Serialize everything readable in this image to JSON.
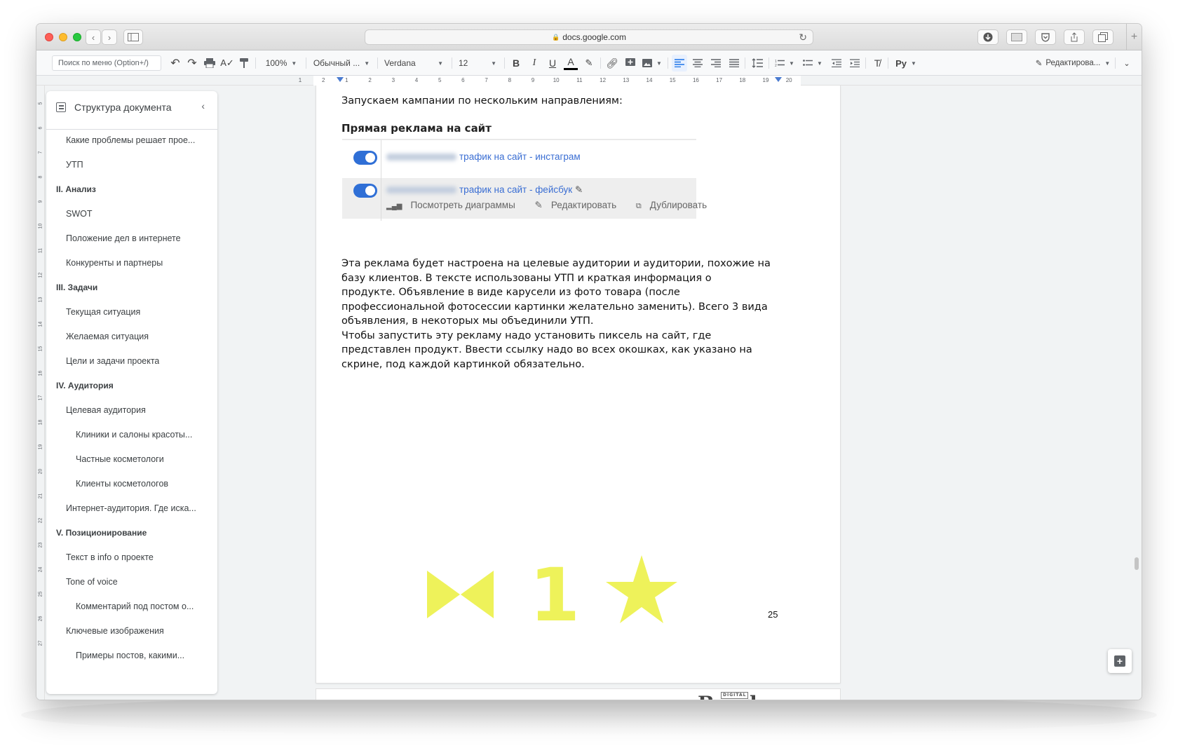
{
  "browser": {
    "url": "docs.google.com",
    "nav_back": "‹",
    "nav_forward": "›",
    "new_tab": "+"
  },
  "toolbar": {
    "search_placeholder": "Поиск по меню (Option+/)",
    "zoom": "100%",
    "style": "Обычный ...",
    "font": "Verdana",
    "font_size": "12",
    "bold": "B",
    "italic": "I",
    "underline": "U",
    "text_color": "A",
    "input_tools": "Ру",
    "editing_mode": "Редактирова..."
  },
  "ruler": {
    "ticks": [
      "1",
      "2",
      "1",
      "2",
      "3",
      "4",
      "5",
      "6",
      "7",
      "8",
      "9",
      "10",
      "11",
      "12",
      "13",
      "14",
      "15",
      "16",
      "17",
      "18",
      "19",
      "20"
    ],
    "vticks": [
      "5",
      "6",
      "7",
      "8",
      "9",
      "10",
      "11",
      "12",
      "13",
      "14",
      "15",
      "16",
      "17",
      "18",
      "19",
      "20",
      "21",
      "22",
      "23",
      "24",
      "25",
      "26",
      "27"
    ]
  },
  "outline": {
    "title": "Структура документа",
    "close": "‹",
    "items": [
      {
        "label": "Какие проблемы решает прое...",
        "level": 1
      },
      {
        "label": "УТП",
        "level": 1
      },
      {
        "label": "II. Анализ",
        "level": 0
      },
      {
        "label": "SWOT",
        "level": 1
      },
      {
        "label": "Положение дел в интернете",
        "level": 1
      },
      {
        "label": "Конкуренты и партнеры",
        "level": 1
      },
      {
        "label": "III. Задачи",
        "level": 0
      },
      {
        "label": "Текущая ситуация",
        "level": 1
      },
      {
        "label": "Желаемая ситуация",
        "level": 1
      },
      {
        "label": "Цели и задачи проекта",
        "level": 1
      },
      {
        "label": "IV. Аудитория",
        "level": 0
      },
      {
        "label": "Целевая аудитория",
        "level": 1
      },
      {
        "label": "Клиники и салоны красоты...",
        "level": 2
      },
      {
        "label": "Частные косметологи",
        "level": 2
      },
      {
        "label": "Клиенты косметологов",
        "level": 2
      },
      {
        "label": "Интернет-аудитория. Где иска...",
        "level": 1
      },
      {
        "label": "V. Позиционирование",
        "level": 0
      },
      {
        "label": "Текст в info о проекте",
        "level": 1
      },
      {
        "label": "Tone of voice",
        "level": 1
      },
      {
        "label": "Комментарий под постом о...",
        "level": 2
      },
      {
        "label": "Ключевые изображения",
        "level": 1
      },
      {
        "label": "Примеры постов, какими...",
        "level": 2
      }
    ]
  },
  "document": {
    "intro": "Запускаем кампании по нескольким направлениям:",
    "heading": "Прямая реклама на сайт",
    "screenshot": {
      "campaign1": "трафик на сайт - инстаграм",
      "campaign2": "трафик на сайт - фейсбук",
      "action_charts": "Посмотреть диаграммы",
      "action_edit": "Редактировать",
      "action_duplicate": "Дублировать"
    },
    "body_lines": [
      "Эта реклама будет настроена на целевые аудитории и аудитории, похожие на",
      "базу клиентов. В тексте использованы УТП и краткая информация о",
      "продукте. Объявление в виде карусели из фото товара (после",
      "профессиональной фотосессии картинки желательно заменить). Всего 3 вида",
      "объявления, в некоторых мы объединили УТП.",
      "Чтобы запустить эту рекламу надо установить пиксель на сайт, где",
      "представлен продукт. Ввести ссылку надо во всех окошках, как указано на",
      "скрине, под каждой картинкой обязательно."
    ],
    "emblem_digit": "1",
    "page_number": "25",
    "logo_text": "Bands",
    "logo_small": "DIGITAL"
  },
  "colors": {
    "accent": "#1a73e8",
    "toggle": "#2f6fd6",
    "campaign_link": "#3a6ed3",
    "emblem": "#eef25a"
  }
}
